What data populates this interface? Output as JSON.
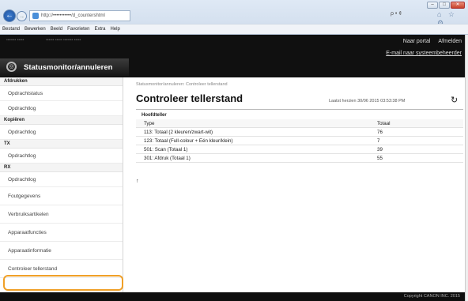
{
  "browser": {
    "address": "http://•••••••••••/d_countershtml",
    "search_hint": "ρ • ¢",
    "home_icons": "⌂ ☆ ⚙",
    "menu": [
      "Bestand",
      "Bewerken",
      "Beeld",
      "Favorieten",
      "Extra",
      "Help"
    ],
    "window_buttons": [
      "–",
      "□",
      "✕"
    ]
  },
  "header": {
    "device_small_1": "••••••• •••••",
    "device_small_2": "•••••• ••••• ••••••• •••••",
    "links": [
      "Naar portal",
      "Afmelden"
    ],
    "email_link": "E-mail naar systeembeheerder",
    "brand_title": "Statusmonitor/annuleren"
  },
  "sidebar": {
    "sections": [
      {
        "title": "Afdrukken",
        "items": [
          "Opdrachtstatus",
          "Opdrachtlog"
        ]
      },
      {
        "title": "Kopiëren",
        "items": [
          "Opdrachtlog"
        ]
      },
      {
        "title": "TX",
        "items": [
          "Opdrachtlog"
        ]
      },
      {
        "title": "RX",
        "items": [
          "Opdrachtlog"
        ]
      }
    ],
    "extra_items": [
      "Foutgegevens",
      "Verbruiksartikelen",
      "Apparaatfuncties",
      "Apparaatinformatie",
      "Controleer tellerstand"
    ]
  },
  "main": {
    "breadcrumb": "Statusmonitor/annuleren: Controleer tellerstand",
    "title": "Controleer tellerstand",
    "updated": "Laatst herzien 30/06 2015 03:53:38 PM",
    "group_title": "Hoofdteller",
    "table": {
      "headers": [
        "Type",
        "Totaal"
      ],
      "rows": [
        [
          "113: Totaal (2 kleuren/zwart-wit)",
          "76"
        ],
        [
          "123: Totaal (Full-colour + Eén kleur/klein)",
          "7"
        ],
        [
          "501: Scan (Totaal 1)",
          "39"
        ],
        [
          "301: Afdruk (Totaal 1)",
          "55"
        ]
      ]
    },
    "top_link": "↑"
  },
  "footer": {
    "copyright": "Copyright CANON INC. 2015"
  }
}
